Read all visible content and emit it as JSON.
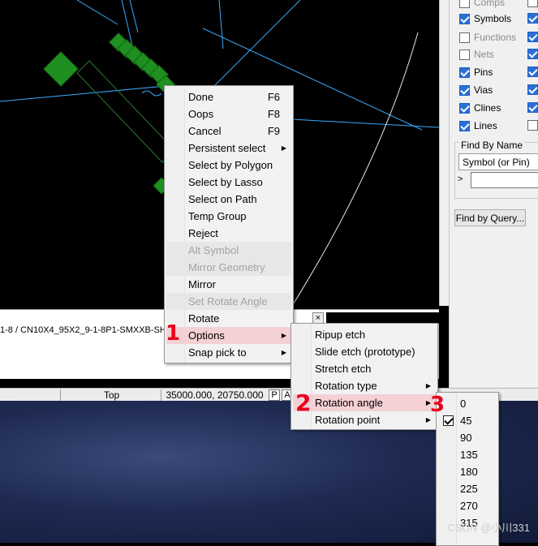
{
  "colors": {
    "pcb_green": "#1f8f1f",
    "trace_cyan": "#3aaaff",
    "highlight_pink": "#f5d0d4",
    "check_blue": "#2a6fd6",
    "annotation_red": "#e8001c"
  },
  "visibility_panel": {
    "rows": [
      {
        "label": "Comps",
        "checked": false,
        "enabled": false
      },
      {
        "label": "Symbols",
        "checked": true,
        "enabled": true
      },
      {
        "label": "Functions",
        "checked": false,
        "enabled": false
      },
      {
        "label": "Nets",
        "checked": false,
        "enabled": false
      },
      {
        "label": "Pins",
        "checked": true,
        "enabled": true
      },
      {
        "label": "Vias",
        "checked": true,
        "enabled": true
      },
      {
        "label": "Clines",
        "checked": true,
        "enabled": true
      },
      {
        "label": "Lines",
        "checked": true,
        "enabled": true
      }
    ],
    "find_by_name": {
      "title": "Find By Name",
      "selected": "Symbol (or Pin)",
      "arrow": ">",
      "input_value": ""
    },
    "find_by_query_label": "Find by Query..."
  },
  "command_window": {
    "text": "1-8 / CN10X4_95X2_9-1-8P1-SMXXB-SH.",
    "close_label": "×"
  },
  "status_bar": {
    "layer": "Top",
    "coords": "35000.000, 20750.000",
    "p_label": "P",
    "a_label": "A"
  },
  "context_menu": {
    "items": [
      {
        "label": "Done",
        "shortcut": "F6"
      },
      {
        "label": "Oops",
        "shortcut": "F8"
      },
      {
        "label": "Cancel",
        "shortcut": "F9"
      },
      {
        "label": "Persistent select",
        "submenu": true
      },
      {
        "label": "Select by Polygon"
      },
      {
        "label": "Select by Lasso"
      },
      {
        "label": "Select on Path"
      },
      {
        "label": "Temp Group"
      },
      {
        "label": "Reject"
      },
      {
        "label": "Alt Symbol",
        "disabled": true
      },
      {
        "label": "Mirror Geometry",
        "disabled": true
      },
      {
        "label": "Mirror"
      },
      {
        "label": "Set Rotate Angle",
        "disabled": true
      },
      {
        "label": "Rotate"
      },
      {
        "label": "Options",
        "submenu": true,
        "highlighted": true
      },
      {
        "label": "Snap pick to",
        "submenu": true
      }
    ]
  },
  "options_submenu": {
    "items": [
      {
        "label": "Ripup etch"
      },
      {
        "label": "Slide etch (prototype)"
      },
      {
        "label": "Stretch etch"
      },
      {
        "label": "Rotation type",
        "submenu": true
      },
      {
        "label": "Rotation angle",
        "submenu": true,
        "highlighted": true
      },
      {
        "label": "Rotation point",
        "submenu": true
      }
    ]
  },
  "angle_submenu": {
    "items": [
      {
        "label": "0"
      },
      {
        "label": "45",
        "checked": true
      },
      {
        "label": "90"
      },
      {
        "label": "135"
      },
      {
        "label": "180"
      },
      {
        "label": "225"
      },
      {
        "label": "270"
      },
      {
        "label": "315"
      }
    ]
  },
  "annotations": {
    "one": "1",
    "two": "2",
    "three": "3"
  },
  "watermark": "CSDN @小川331"
}
